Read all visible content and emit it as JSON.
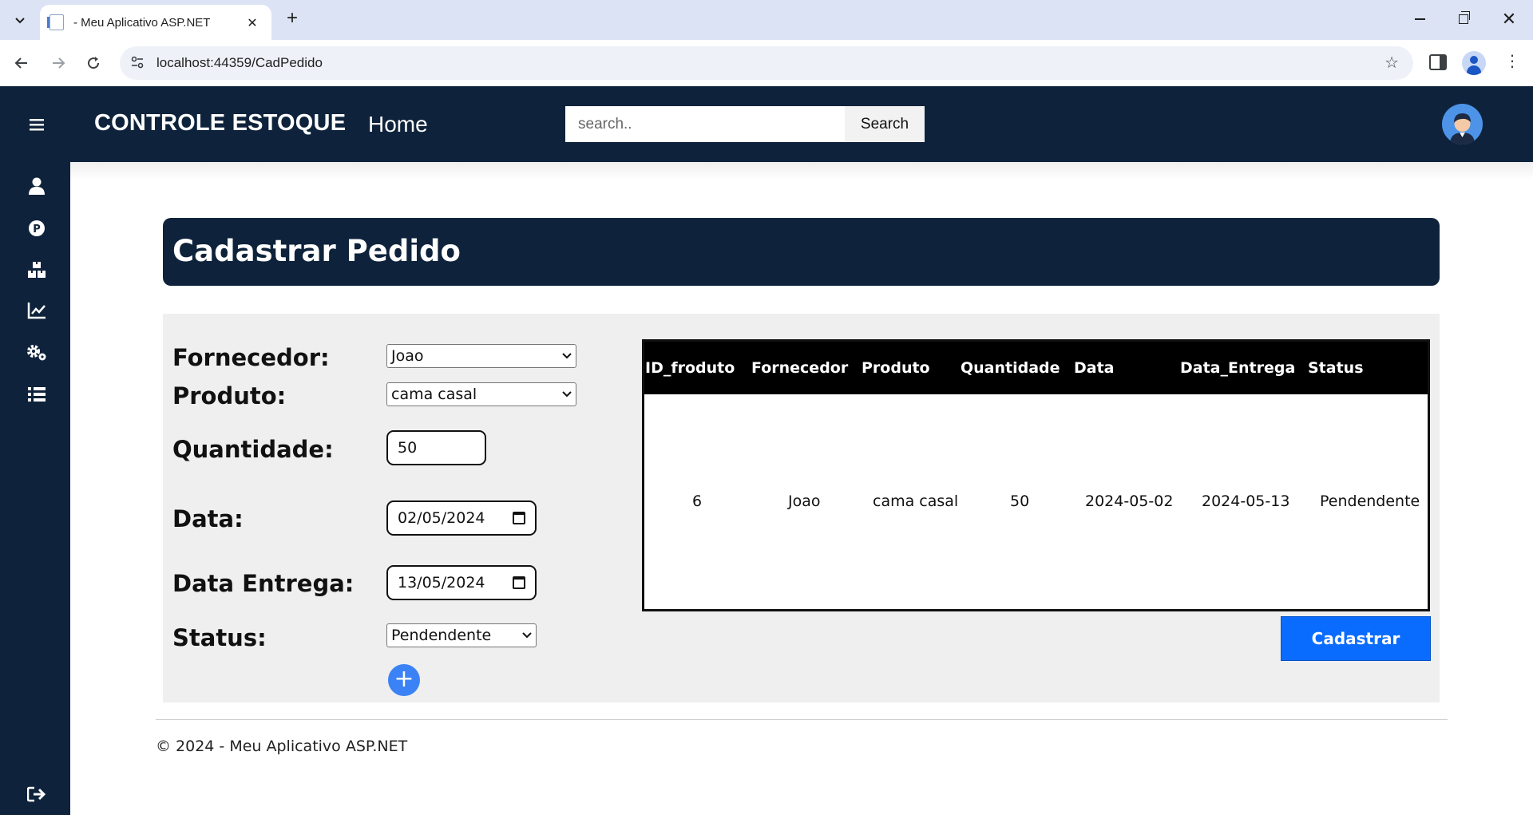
{
  "browser": {
    "tab_title": "- Meu Aplicativo ASP.NET",
    "new_tab_glyph": "+",
    "close_tab_glyph": "✕",
    "url": "localhost:44359/CadPedido"
  },
  "topbar": {
    "brand": "CONTROLE ESTOQUE",
    "home": "Home",
    "search_placeholder": "search..",
    "search_button": "Search"
  },
  "sidebar": {
    "items": [
      {
        "icon": "menu-icon"
      },
      {
        "icon": "user-icon"
      },
      {
        "icon": "parking-icon"
      },
      {
        "icon": "boxes-icon"
      },
      {
        "icon": "chart-line-icon"
      },
      {
        "icon": "gears-icon"
      },
      {
        "icon": "list-icon"
      },
      {
        "icon": "logout-icon"
      }
    ]
  },
  "page": {
    "title": "Cadastrar Pedido"
  },
  "form": {
    "fornecedor_label": "Fornecedor:",
    "fornecedor_value": "Joao",
    "produto_label": "Produto:",
    "produto_value": "cama casal",
    "quantidade_label": "Quantidade:",
    "quantidade_value": "50",
    "data_label": "Data:",
    "data_value": "02/05/2024",
    "data_entrega_label": "Data Entrega:",
    "data_entrega_value": "13/05/2024",
    "status_label": "Status:",
    "status_value": "Pendendente",
    "add_glyph": "+",
    "submit_label": "Cadastrar"
  },
  "table": {
    "headers": [
      "ID_froduto",
      "Fornecedor",
      "Produto",
      "Quantidade",
      "Data",
      "Data_Entrega",
      "Status"
    ],
    "rows": [
      [
        "6",
        "Joao",
        "cama casal",
        "50",
        "2024-05-02",
        "2024-05-13",
        "Pendendente"
      ]
    ]
  },
  "footer": {
    "text": "© 2024 - Meu Aplicativo ASP.NET"
  },
  "colors": {
    "navy": "#0e233b",
    "primary_button": "#0a6cff",
    "add_button": "#3b82f6",
    "panel_bg": "#efefef"
  }
}
